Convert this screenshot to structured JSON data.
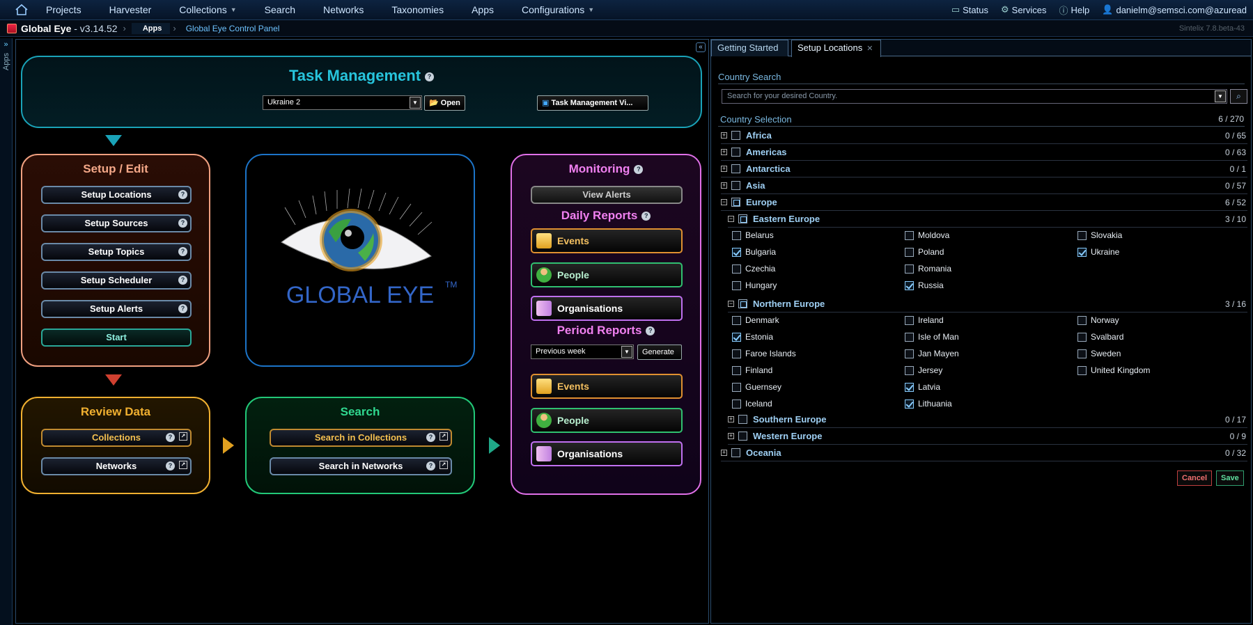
{
  "nav": {
    "items": [
      "Projects",
      "Harvester",
      "Collections",
      "Search",
      "Networks",
      "Taxonomies",
      "Apps",
      "Configurations"
    ],
    "status": "Status",
    "services": "Services",
    "help": "Help",
    "user": "danielm@semsci.com@azuread"
  },
  "breadcrumb": {
    "app_title": "Global Eye",
    "app_version": " - v3.14.52",
    "crumb1": "Apps",
    "crumb2": "Global Eye Control Panel",
    "version": "Sintelix 7.8.beta-43"
  },
  "sidebar_tab": "Apps",
  "task": {
    "title": "Task Management",
    "selected": "Ukraine 2",
    "open_label": "Open",
    "view_label": "Task Management Vi..."
  },
  "setup": {
    "title": "Setup / Edit",
    "buttons": [
      "Setup Locations",
      "Setup Sources",
      "Setup Topics",
      "Setup Scheduler",
      "Setup Alerts"
    ],
    "start": "Start"
  },
  "logo": {
    "text": "GLOBAL EYE",
    "tm": "TM"
  },
  "monitoring": {
    "title": "Monitoring",
    "view_alerts": "View Alerts",
    "daily_title": "Daily Reports",
    "period_title": "Period Reports",
    "period_value": "Previous week",
    "generate": "Generate",
    "events": "Events",
    "people": "People",
    "organisations": "Organisations"
  },
  "review": {
    "title": "Review Data",
    "collections": "Collections",
    "networks": "Networks"
  },
  "search": {
    "title": "Search",
    "in_collections": "Search in Collections",
    "in_networks": "Search in Networks"
  },
  "right": {
    "tabs": [
      "Getting Started",
      "Setup Locations"
    ],
    "country_search_label": "Country Search",
    "search_placeholder": "Search for your desired Country.",
    "selection_label": "Country Selection",
    "selection_count": "6 / 270",
    "regions": [
      {
        "name": "Africa",
        "count": "0 / 65"
      },
      {
        "name": "Americas",
        "count": "0 / 63"
      },
      {
        "name": "Antarctica",
        "count": "0 / 1"
      },
      {
        "name": "Asia",
        "count": "0 / 57"
      },
      {
        "name": "Europe",
        "count": "6 / 52"
      },
      {
        "name": "Oceania",
        "count": "0 / 32"
      }
    ],
    "subregions": [
      {
        "name": "Eastern Europe",
        "count": "3 / 10"
      },
      {
        "name": "Northern Europe",
        "count": "3 / 16"
      },
      {
        "name": "Southern Europe",
        "count": "0 / 17"
      },
      {
        "name": "Western Europe",
        "count": "0 / 9"
      }
    ],
    "eastern": [
      {
        "name": "Belarus",
        "checked": false
      },
      {
        "name": "Moldova",
        "checked": false
      },
      {
        "name": "Slovakia",
        "checked": false
      },
      {
        "name": "Bulgaria",
        "checked": true
      },
      {
        "name": "Poland",
        "checked": false
      },
      {
        "name": "Ukraine",
        "checked": true
      },
      {
        "name": "Czechia",
        "checked": false
      },
      {
        "name": "Romania",
        "checked": false
      },
      {
        "name": "Hungary",
        "checked": false
      },
      {
        "name": "Russia",
        "checked": true
      }
    ],
    "northern": [
      {
        "name": "Denmark",
        "checked": false
      },
      {
        "name": "Ireland",
        "checked": false
      },
      {
        "name": "Norway",
        "checked": false
      },
      {
        "name": "Estonia",
        "checked": true
      },
      {
        "name": "Isle of Man",
        "checked": false
      },
      {
        "name": "Svalbard",
        "checked": false
      },
      {
        "name": "Faroe Islands",
        "checked": false
      },
      {
        "name": "Jan Mayen",
        "checked": false
      },
      {
        "name": "Sweden",
        "checked": false
      },
      {
        "name": "Finland",
        "checked": false
      },
      {
        "name": "Jersey",
        "checked": false
      },
      {
        "name": "United Kingdom",
        "checked": false
      },
      {
        "name": "Guernsey",
        "checked": false
      },
      {
        "name": "Latvia",
        "checked": true
      },
      {
        "name": "Iceland",
        "checked": false
      },
      {
        "name": "Lithuania",
        "checked": true
      }
    ],
    "cancel": "Cancel",
    "save": "Save"
  },
  "colors": {
    "setup": "#f0a080",
    "eye": "#1c74c8",
    "monitor": "#e070e8",
    "review": "#f0b030",
    "search": "#22c878",
    "task": "#1aa3b8"
  }
}
